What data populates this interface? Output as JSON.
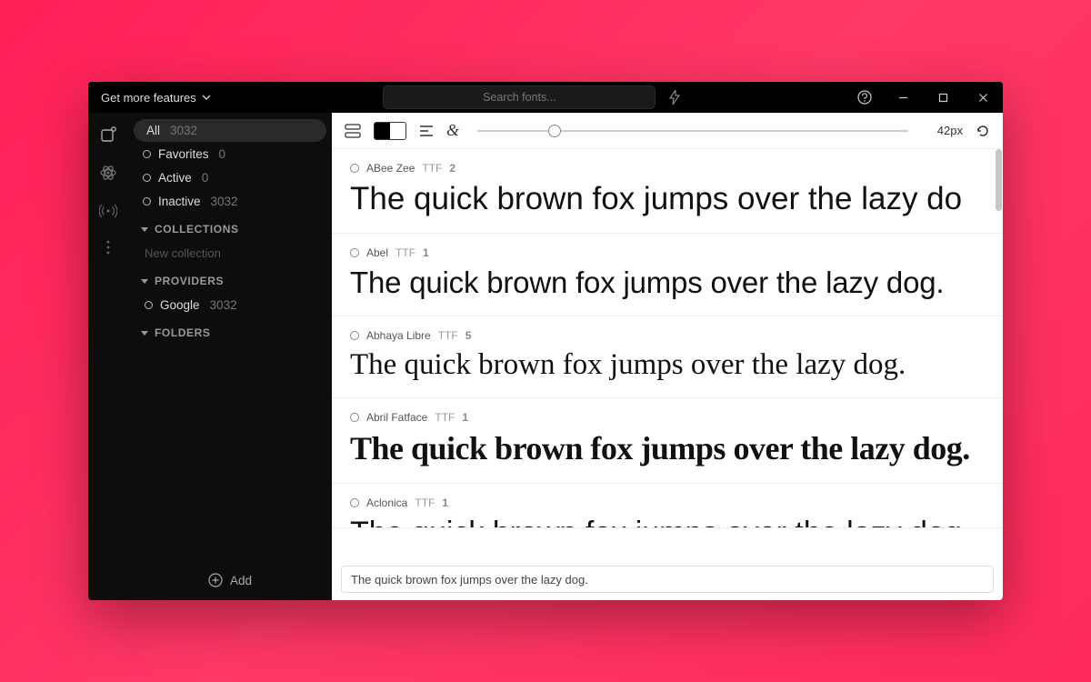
{
  "titlebar": {
    "get_more": "Get more features",
    "search_placeholder": "Search fonts..."
  },
  "sidebar": {
    "filters": [
      {
        "label": "All",
        "count": "3032",
        "active": true
      },
      {
        "label": "Favorites",
        "count": "0",
        "active": false
      },
      {
        "label": "Active",
        "count": "0",
        "active": false
      },
      {
        "label": "Inactive",
        "count": "3032",
        "active": false
      }
    ],
    "section_collections": "COLLECTIONS",
    "new_collection": "New collection",
    "section_providers": "PROVIDERS",
    "providers": [
      {
        "name": "Google",
        "count": "3032"
      }
    ],
    "section_folders": "FOLDERS",
    "add_label": "Add"
  },
  "toolbar": {
    "size_label": "42px"
  },
  "fonts": [
    {
      "name": "ABee Zee",
      "type": "TTF",
      "count": "2",
      "css": "row-abeezee"
    },
    {
      "name": "Abel",
      "type": "TTF",
      "count": "1",
      "css": "row-abel"
    },
    {
      "name": "Abhaya Libre",
      "type": "TTF",
      "count": "5",
      "css": "row-abhaya"
    },
    {
      "name": "Abril Fatface",
      "type": "TTF",
      "count": "1",
      "css": "row-abril"
    },
    {
      "name": "Aclonica",
      "type": "TTF",
      "count": "1",
      "css": "row-aclonica"
    }
  ],
  "sample_text": "The quick brown fox jumps over the lazy dog.",
  "sample_text_clipped": "The quick brown fox jumps over the lazy do",
  "preview_input": "The quick brown fox jumps over the lazy dog."
}
